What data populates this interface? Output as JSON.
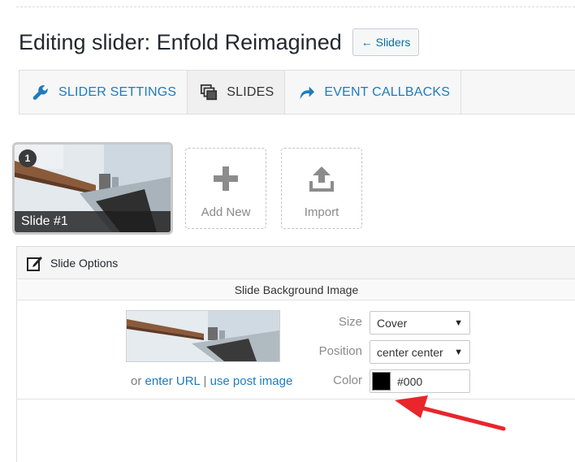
{
  "header": {
    "title": "Editing slider: Enfold Reimagined",
    "back_label": "← Sliders"
  },
  "tabs": [
    {
      "label": "SLIDER SETTINGS",
      "icon": "wrench-icon"
    },
    {
      "label": "SLIDES",
      "icon": "slides-icon"
    },
    {
      "label": "EVENT CALLBACKS",
      "icon": "curved-arrow-icon"
    }
  ],
  "slides": {
    "items": [
      {
        "number": "1",
        "label": "Slide #1"
      }
    ],
    "add_new_label": "Add New",
    "import_label": "Import"
  },
  "slide_options": {
    "title": "Slide Options",
    "section_title": "Slide Background Image",
    "link_prefix": "or ",
    "enter_url_label": "enter URL",
    "separator": " | ",
    "use_post_image_label": "use post image",
    "size_label": "Size",
    "size_value": "Cover",
    "position_label": "Position",
    "position_value": "center center",
    "color_label": "Color",
    "color_value": "#000"
  },
  "colors": {
    "accent": "#1f7bbd",
    "swatch": "#000000",
    "annotation": "#e8262b"
  }
}
